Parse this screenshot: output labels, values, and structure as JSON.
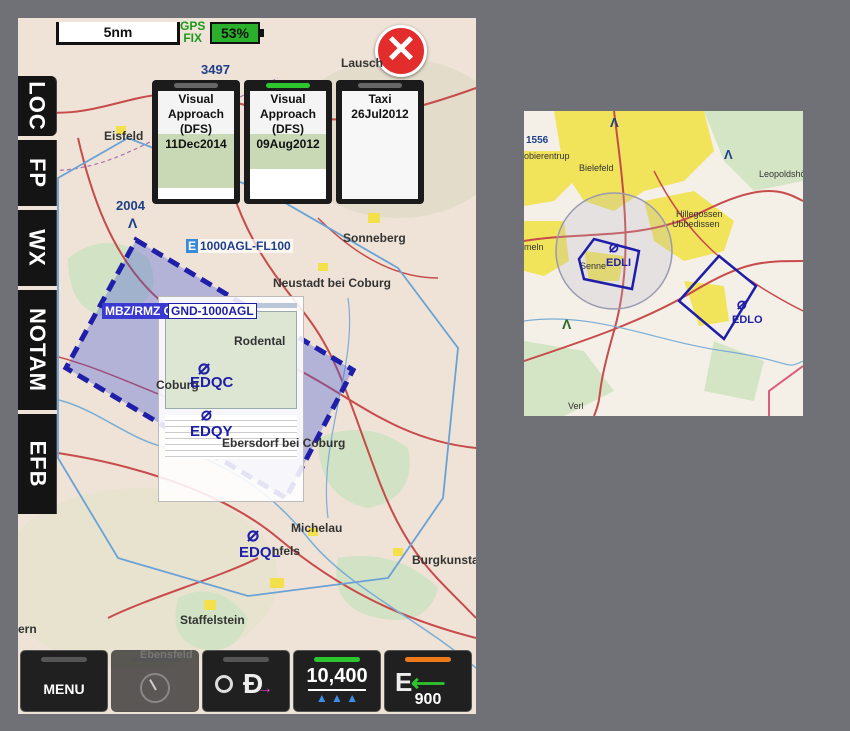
{
  "side_tabs": [
    "LOC",
    "FP",
    "WX",
    "NOTAM",
    "EFB"
  ],
  "scale": "5nm",
  "gps": {
    "line1": "GPS",
    "line2": "FIX",
    "battery": "53%"
  },
  "charts": [
    {
      "line1": "Visual",
      "line2": "Approach",
      "line3": "(DFS)",
      "line4": "11Dec2014"
    },
    {
      "line1": "Visual",
      "line2": "Approach",
      "line3": "(DFS)",
      "line4": "09Aug2012"
    },
    {
      "line1": "Taxi",
      "line2": "26Jul2012",
      "line3": "",
      "line4": ""
    }
  ],
  "map_labels": {
    "elev_3497": "3497",
    "lausch": "Lausch",
    "eisfeld": "Eisfeld",
    "elev_2004": "2004",
    "airspace_e": "E",
    "airspace_e_limits": "1000AGL-FL100",
    "sonneberg": "Sonneberg",
    "neustadt": "Neustadt bei Coburg",
    "mbz": "MBZ/RMZ G",
    "mbz_limits": "GND-1000AGL",
    "rodental": "Rodental",
    "coburg": "Coburg",
    "edqc": "EDQC",
    "edqy": "EDQY",
    "ebersdorf": "Ebersdorf bei Coburg",
    "michelau": "Michelau",
    "edql": "EDQL",
    "lichtenfels": "nfels",
    "burgkunstadt": "Burgkunstad",
    "staffelstein": "Staffelstein",
    "ern": "ern",
    "ebensfeld": "Ebensfeld"
  },
  "toolbar": {
    "menu": "MENU",
    "altitude": "10,400",
    "alt_arrows": "▲ ▲ ▲",
    "distance": "900"
  },
  "side_map": {
    "elev_1556": "1556",
    "bierentrup": "obierentrup",
    "bielefeld": "Bielefeld",
    "leopoldshohe": "Leopoldshöh",
    "hillegossen": "Hillegossen",
    "ubbedissen": "Ubbedissen",
    "hameln": "meln",
    "senne": "Senne",
    "edli": "EDLI",
    "edlo": "EDLO",
    "verl": "Verl"
  },
  "colors": {
    "accent_green": "#2ec62e",
    "accent_orange": "#f07a1a",
    "close_red": "#e32d2d",
    "airspace_blue": "#1e1ea8"
  }
}
